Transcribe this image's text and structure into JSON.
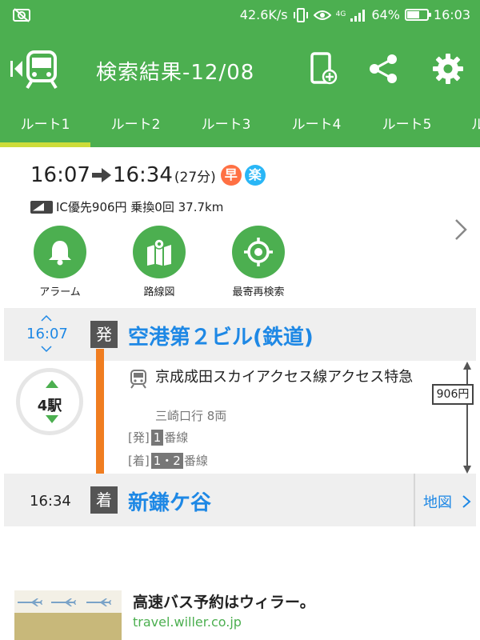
{
  "status_bar": {
    "net_speed": "42.6K/s",
    "net_type": "4G",
    "battery": "64%",
    "battery_level": 0.64,
    "time": "16:03"
  },
  "app_bar": {
    "title": "検索結果-12/08",
    "icons": [
      "back-train-icon",
      "phone-add-icon",
      "share-icon",
      "gear-icon"
    ]
  },
  "tabs": [
    {
      "label": "ルート1",
      "active": true
    },
    {
      "label": "ルート2"
    },
    {
      "label": "ルート3"
    },
    {
      "label": "ルート4"
    },
    {
      "label": "ルート5"
    },
    {
      "label": "ル"
    }
  ],
  "summary": {
    "depart": "16:07",
    "arrive": "16:34",
    "duration": "(27分)",
    "badges": [
      {
        "label": "早",
        "color": "#ff7043"
      },
      {
        "label": "楽",
        "color": "#29b6f6"
      }
    ],
    "info": "IC優先906円 乗換0回 37.7km"
  },
  "actions": [
    {
      "label": "アラーム",
      "icon": "bell-icon"
    },
    {
      "label": "路線図",
      "icon": "map-pin-icon"
    },
    {
      "label": "最寄再検索",
      "icon": "crosshair-icon"
    }
  ],
  "route": {
    "departure": {
      "time": "16:07",
      "tag": "発",
      "station": "空港第２ビル(鉄道)"
    },
    "stops": "4駅",
    "line": "京成成田スカイアクセス線アクセス特急",
    "direction": "三崎口行 8両",
    "platform_dep": {
      "prefix": "[発]",
      "number": "1",
      "suffix": "番線"
    },
    "platform_arr": {
      "prefix": "[着]",
      "number": "1・2",
      "suffix": "番線"
    },
    "fare": "906円",
    "arrival": {
      "time": "16:34",
      "tag": "着",
      "station": "新鎌ケ谷"
    },
    "map_label": "地図"
  },
  "ad": {
    "title": "高速バス予約はウィラー。",
    "url": "travel.willer.co.jp"
  },
  "colors": {
    "primary": "#4caf50",
    "tab_indicator": "#cddc39",
    "link": "#1e88e5",
    "line": "#f07d20"
  }
}
